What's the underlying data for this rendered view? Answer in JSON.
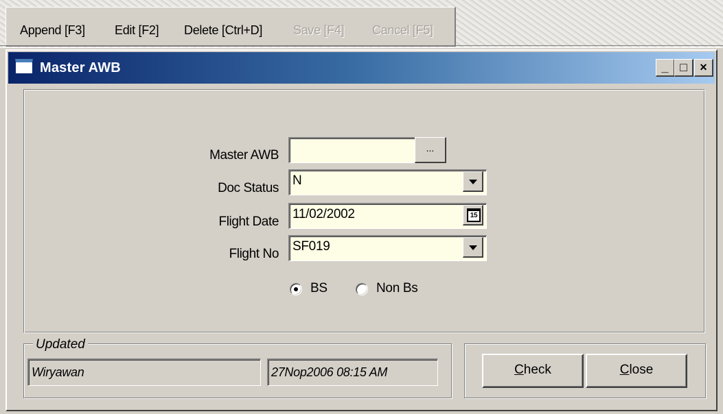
{
  "menu": {
    "append": "Append [F3]",
    "edit": "Edit [F2]",
    "delete": "Delete [Ctrl+D]",
    "save": "Save [F4]",
    "cancel": "Cancel [F5]"
  },
  "window": {
    "title": "Master AWB",
    "minimize_glyph": "_",
    "maximize_glyph": "□",
    "close_glyph": "×"
  },
  "form": {
    "master_awb_label": "Master AWB",
    "master_awb_value": "",
    "browse_glyph": "...",
    "doc_status_label": "Doc Status",
    "doc_status_value": "N",
    "flight_date_label": "Flight Date",
    "flight_date_value": "11/02/2002",
    "calendar_glyph": "15",
    "flight_no_label": "Flight No",
    "flight_no_value": "SF019",
    "radio_bs_label": "BS",
    "radio_nonbs_label": "Non Bs",
    "radio_selected": "BS"
  },
  "updated": {
    "legend": "Updated",
    "user": "Wiryawan",
    "timestamp": "27Nop2006  08:15 AM"
  },
  "buttons": {
    "check_hotkey": "C",
    "check_rest": "heck",
    "close_hotkey": "C",
    "close_rest": "lose"
  }
}
